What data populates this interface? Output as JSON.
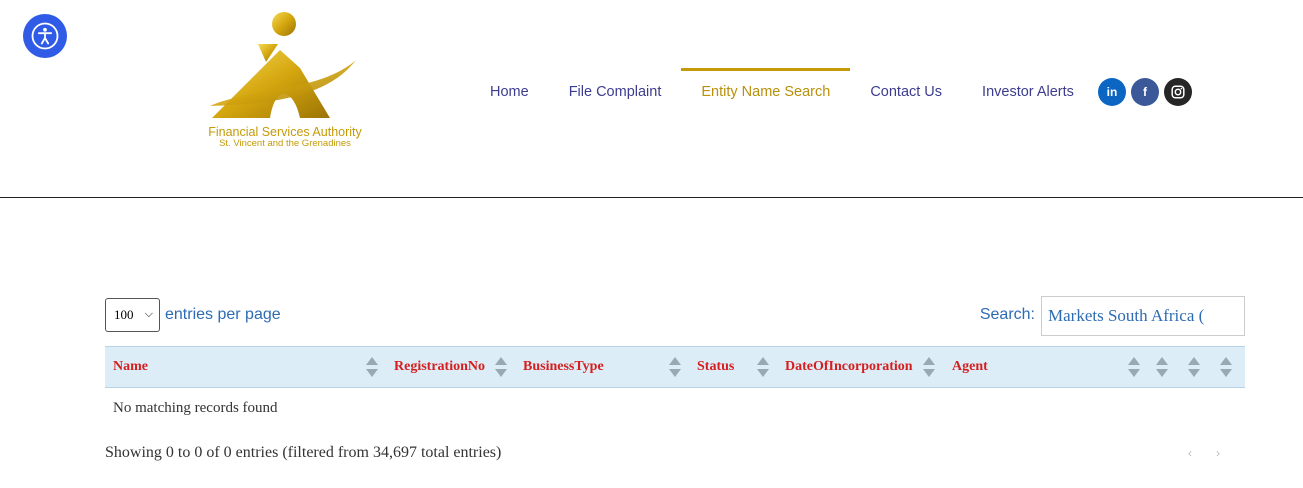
{
  "accessibility": {
    "icon": "accessibility-icon"
  },
  "logo": {
    "line1": "Financial Services Authority",
    "line2": "St. Vincent and the Grenadines",
    "color": "#c49a08"
  },
  "nav": {
    "items": [
      {
        "label": "Home",
        "active": false
      },
      {
        "label": "File Complaint",
        "active": false
      },
      {
        "label": "Entity Name Search",
        "active": true
      },
      {
        "label": "Contact Us",
        "active": false
      },
      {
        "label": "Investor Alerts",
        "active": false
      }
    ]
  },
  "social": {
    "linkedin": "in",
    "facebook": "f",
    "instagram": "instagram-icon"
  },
  "controls": {
    "per_page_value": "100",
    "per_page_label": "entries per page",
    "search_label": "Search:",
    "search_value": "Markets South Africa ("
  },
  "table": {
    "columns": [
      "Name",
      "RegistrationNo",
      "BusinessType",
      "Status",
      "DateOfIncorporation",
      "Agent",
      "",
      "",
      ""
    ],
    "empty_message": "No matching records found"
  },
  "footer": {
    "info": "Showing 0 to 0 of 0 entries (filtered from 34,697 total entries)",
    "prev": "‹",
    "next": "›"
  },
  "colors": {
    "accent_gold": "#c49a08",
    "nav_text": "#3d3d8f",
    "header_red": "#d51f1f",
    "link_blue": "#2d6cb3",
    "table_head_bg": "#dcedf8"
  }
}
